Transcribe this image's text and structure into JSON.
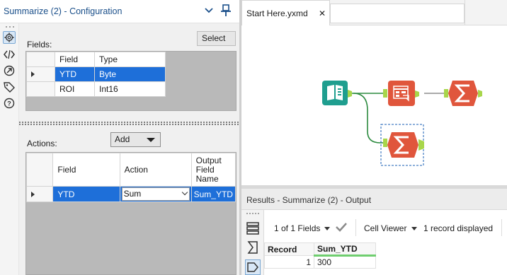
{
  "config": {
    "title": "Summarize (2) - Configuration",
    "select_button": "Select",
    "fields_label": "Fields:",
    "fields_columns": [
      "Field",
      "Type"
    ],
    "fields_rows": [
      {
        "field": "YTD",
        "type": "Byte",
        "selected": true
      },
      {
        "field": "ROI",
        "type": "Int16",
        "selected": false
      }
    ],
    "actions_label": "Actions:",
    "add_dropdown": "Add",
    "actions_columns": [
      "Field",
      "Action",
      "Output Field Name"
    ],
    "actions_rows": [
      {
        "field": "YTD",
        "action": "Sum",
        "output": "Sum_YTD",
        "selected": true
      }
    ]
  },
  "tabs": [
    {
      "label": "Start Here.yxmd",
      "close": "✕",
      "active": true
    }
  ],
  "workflow": {
    "nodes": [
      "input-data-tool",
      "select-tool",
      "summarize-tool",
      "summarize-tool-selected"
    ],
    "accent_colors": {
      "input": "#1f9e8f",
      "tool": "#e0563c",
      "connector": "#a8d64b",
      "wire": "#2b8a3e"
    }
  },
  "results": {
    "title": "Results - Summarize (2) - Output",
    "fields_count": "1 of 1 Fields",
    "cell_viewer": "Cell Viewer",
    "records_displayed": "1 record displayed",
    "columns": [
      "Record",
      "Sum_YTD"
    ],
    "rows": [
      {
        "record": "1",
        "sum_ytd": "300"
      }
    ]
  },
  "colors": {
    "selection": "#1e6fd9",
    "title_blue": "#1a4f8a",
    "highlight_green": "#6fce6f"
  }
}
